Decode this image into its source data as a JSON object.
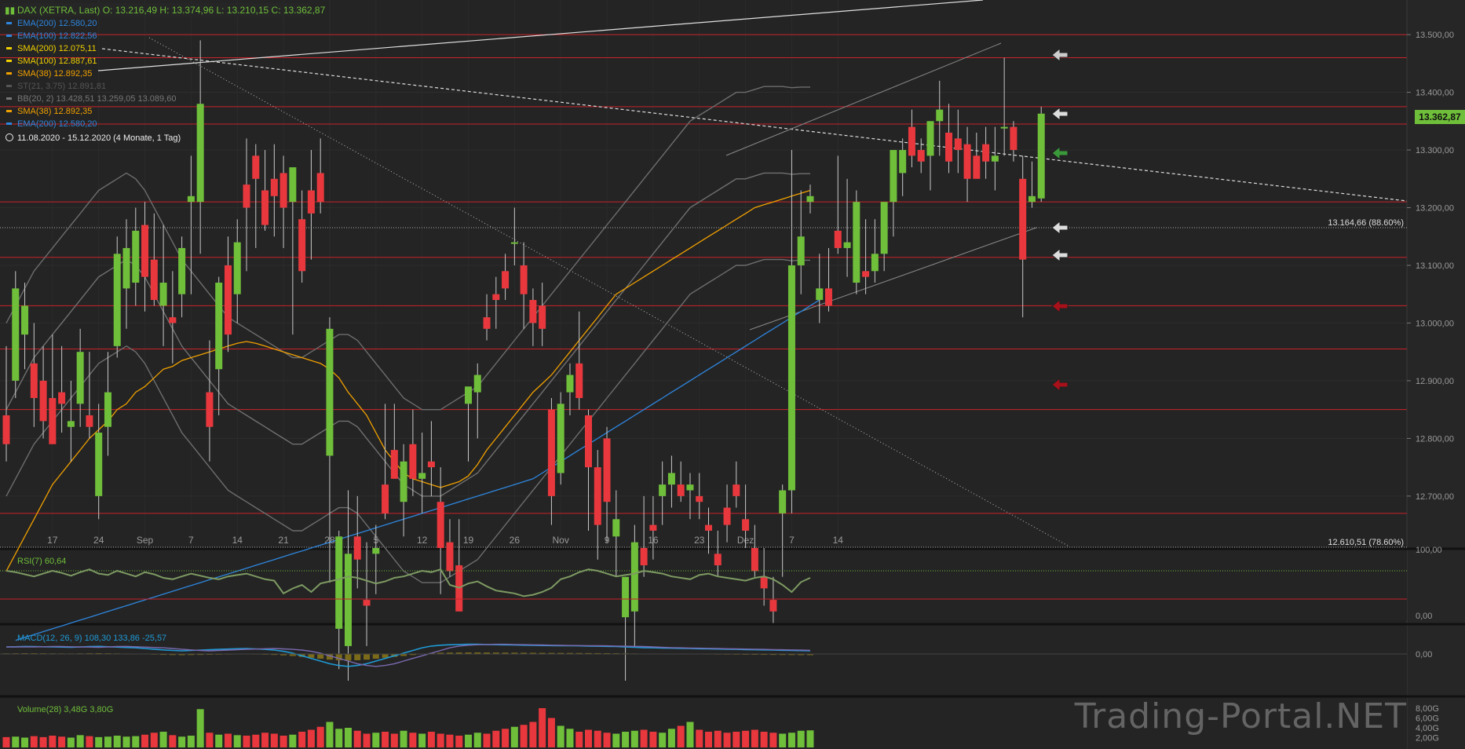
{
  "header": {
    "symbol": "DAX (XETRA, Last)",
    "ohlc": "O: 13.216,49  H: 13.374,96  L: 13.210,15  C: 13.362,87",
    "range": "11.08.2020 - 15.12.2020",
    "range_note": "(4 Monate, 1 Tag)"
  },
  "legend": [
    {
      "name": "EMA(200)",
      "value": "12.580,20",
      "color": "#2e86de"
    },
    {
      "name": "EMA(100)",
      "value": "12.822,56",
      "color": "#2e86de"
    },
    {
      "name": "SMA(200)",
      "value": "12.075,11",
      "color": "#f0d000"
    },
    {
      "name": "SMA(100)",
      "value": "12.887,61",
      "color": "#f0d000"
    },
    {
      "name": "SMA(38)",
      "value": "12.892,35",
      "color": "#f0a000"
    },
    {
      "name": "ST(21, 3.75)",
      "value": "12.891,81",
      "color": "#555555"
    },
    {
      "name": "BB(20, 2)",
      "value": "13.428,51  13.259,05  13.089,60",
      "color": "#777777"
    },
    {
      "name": "SMA(38)",
      "value": "12.892,35",
      "color": "#f0a000"
    },
    {
      "name": "EMA(200)",
      "value": "12.580,20",
      "color": "#2e86de"
    }
  ],
  "price_badge": "13.362,87",
  "fib_labels": {
    "upper": "13.164,66 (88.60%)",
    "lower": "12.610,51 (78.60%)"
  },
  "brand": "Trading-Portal.NET",
  "chart_data": {
    "type": "candlestick",
    "y_axis": {
      "min": 12610,
      "max": 13560,
      "ticks": [
        "13.500,00",
        "13.400,00",
        "13.300,00",
        "13.200,00",
        "13.100,00",
        "13.000,00",
        "12.900,00",
        "12.800,00",
        "12.700,00"
      ],
      "tick_values": [
        13500,
        13400,
        13300,
        13200,
        13100,
        13000,
        12900,
        12800,
        12700
      ]
    },
    "x_ticks": [
      "17",
      "24",
      "Sep",
      "7",
      "14",
      "21",
      "28",
      "5",
      "12",
      "19",
      "26",
      "Nov",
      "9",
      "16",
      "23",
      "Dez",
      "7",
      "14"
    ],
    "x_tick_index": [
      5,
      10,
      15,
      20,
      25,
      30,
      35,
      40,
      45,
      50,
      55,
      60,
      65,
      70,
      75,
      80,
      85,
      90
    ],
    "candles": [
      [
        12840,
        12960,
        12760,
        12790
      ],
      [
        12900,
        13090,
        12870,
        13060
      ],
      [
        12980,
        13070,
        12920,
        13030
      ],
      [
        12930,
        13000,
        12820,
        12870
      ],
      [
        12900,
        12960,
        12800,
        12830
      ],
      [
        12870,
        12980,
        12810,
        12790
      ],
      [
        12880,
        12960,
        12810,
        12860
      ],
      [
        12820,
        12900,
        12760,
        12830
      ],
      [
        12860,
        12990,
        12820,
        12950
      ],
      [
        12840,
        12950,
        12800,
        12820
      ],
      [
        12700,
        12860,
        12660,
        12810
      ],
      [
        12820,
        12950,
        12770,
        12880
      ],
      [
        12960,
        13150,
        12940,
        13120
      ],
      [
        13060,
        13180,
        12990,
        13130
      ],
      [
        13070,
        13200,
        13030,
        13160
      ],
      [
        13170,
        13210,
        13020,
        13080
      ],
      [
        13110,
        13190,
        13030,
        13040
      ],
      [
        13030,
        13170,
        12960,
        13070
      ],
      [
        13010,
        13090,
        12930,
        13000
      ],
      [
        13050,
        13150,
        13010,
        13130
      ],
      [
        13210,
        13290,
        13050,
        13220
      ],
      [
        13210,
        13490,
        13120,
        13380
      ],
      [
        12880,
        12970,
        12760,
        12820
      ],
      [
        12920,
        13080,
        12840,
        13070
      ],
      [
        13100,
        13150,
        12950,
        12980
      ],
      [
        13050,
        13180,
        13000,
        13140
      ],
      [
        13240,
        13320,
        13090,
        13200
      ],
      [
        13290,
        13310,
        13130,
        13250
      ],
      [
        13230,
        13300,
        13160,
        13170
      ],
      [
        13250,
        13310,
        13150,
        13220
      ],
      [
        13260,
        13290,
        13130,
        13200
      ],
      [
        13210,
        13250,
        12980,
        13270
      ],
      [
        13180,
        13230,
        13070,
        13090
      ],
      [
        13230,
        13300,
        13110,
        13190
      ],
      [
        13260,
        13320,
        13190,
        13210
      ],
      [
        12770,
        13010,
        12550,
        12990
      ],
      [
        12470,
        12640,
        12400,
        12630
      ],
      [
        12440,
        12710,
        12380,
        12600
      ],
      [
        12630,
        12700,
        12540,
        12590
      ],
      [
        12520,
        12620,
        12440,
        12510
      ],
      [
        12600,
        12650,
        12530,
        12610
      ],
      [
        12720,
        12860,
        12660,
        12670
      ],
      [
        12780,
        12860,
        12740,
        12730
      ],
      [
        12690,
        12790,
        12630,
        12760
      ],
      [
        12790,
        12850,
        12700,
        12730
      ],
      [
        12730,
        12810,
        12670,
        12740
      ],
      [
        12760,
        12830,
        12700,
        12750
      ],
      [
        12690,
        12750,
        12530,
        12610
      ],
      [
        12620,
        12660,
        12560,
        12570
      ],
      [
        12580,
        12660,
        12520,
        12500
      ],
      [
        12860,
        12880,
        12760,
        12890
      ],
      [
        12880,
        12930,
        12800,
        12910
      ],
      [
        13010,
        13050,
        12970,
        12990
      ],
      [
        13050,
        13080,
        12990,
        13040
      ],
      [
        13090,
        13120,
        13040,
        13060
      ],
      [
        13140,
        13200,
        13100,
        13140
      ],
      [
        13100,
        13140,
        12990,
        13050
      ],
      [
        13040,
        13060,
        12960,
        13000
      ],
      [
        13030,
        13070,
        12960,
        12990
      ],
      [
        12850,
        12870,
        12650,
        12700
      ],
      [
        12740,
        12880,
        12720,
        12860
      ],
      [
        12880,
        12930,
        12840,
        12910
      ],
      [
        12930,
        13020,
        12850,
        12870
      ],
      [
        12840,
        12850,
        12640,
        12750
      ],
      [
        12750,
        12780,
        12590,
        12650
      ],
      [
        12800,
        12820,
        12620,
        12690
      ],
      [
        12630,
        12710,
        12560,
        12660
      ],
      [
        12490,
        12560,
        12380,
        12560
      ],
      [
        12500,
        12650,
        12440,
        12620
      ],
      [
        12610,
        12700,
        12560,
        12580
      ],
      [
        12650,
        12700,
        12590,
        12640
      ],
      [
        12700,
        12760,
        12650,
        12720
      ],
      [
        12720,
        12770,
        12680,
        12740
      ],
      [
        12720,
        12760,
        12690,
        12700
      ],
      [
        12710,
        12740,
        12660,
        12720
      ],
      [
        12700,
        12740,
        12660,
        12690
      ],
      [
        12650,
        12680,
        12600,
        12640
      ],
      [
        12600,
        12640,
        12560,
        12580
      ],
      [
        12680,
        12720,
        12620,
        12650
      ],
      [
        12720,
        12760,
        12680,
        12700
      ],
      [
        12660,
        12720,
        12610,
        12640
      ],
      [
        12610,
        12650,
        12560,
        12570
      ],
      [
        12560,
        12610,
        12510,
        12540
      ],
      [
        12520,
        12560,
        12480,
        12500
      ],
      [
        12670,
        12720,
        12560,
        12710
      ],
      [
        12710,
        13300,
        12670,
        13100
      ],
      [
        13100,
        13230,
        13050,
        13150
      ],
      [
        13210,
        13240,
        13190,
        13220
      ],
      [
        13040,
        13120,
        13000,
        13060
      ],
      [
        13060,
        13130,
        13020,
        13030
      ],
      [
        13160,
        13290,
        13120,
        13130
      ],
      [
        13130,
        13250,
        13080,
        13140
      ],
      [
        13070,
        13230,
        13050,
        13210
      ],
      [
        13090,
        13180,
        13050,
        13080
      ],
      [
        13090,
        13180,
        13070,
        13120
      ],
      [
        13120,
        13200,
        13090,
        13210
      ],
      [
        13210,
        13250,
        13150,
        13300
      ],
      [
        13260,
        13320,
        13220,
        13300
      ],
      [
        13340,
        13370,
        13270,
        13290
      ],
      [
        13300,
        13320,
        13260,
        13280
      ],
      [
        13290,
        13320,
        13230,
        13350
      ],
      [
        13350,
        13420,
        13290,
        13370
      ],
      [
        13330,
        13380,
        13260,
        13280
      ],
      [
        13320,
        13370,
        13260,
        13300
      ],
      [
        13310,
        13340,
        13210,
        13250
      ],
      [
        13290,
        13330,
        13260,
        13250
      ],
      [
        13310,
        13340,
        13250,
        13280
      ],
      [
        13280,
        13340,
        13230,
        13290
      ],
      [
        13340,
        13460,
        13290,
        13340
      ],
      [
        13340,
        13350,
        13280,
        13300
      ],
      [
        13250,
        13290,
        13010,
        13110
      ],
      [
        13210,
        13280,
        13200,
        13220
      ],
      [
        13216,
        13375,
        13210,
        13363
      ]
    ],
    "sma38": [
      12570,
      12600,
      12630,
      12660,
      12690,
      12720,
      12740,
      12760,
      12780,
      12800,
      12815,
      12830,
      12850,
      12860,
      12880,
      12890,
      12905,
      12920,
      12925,
      12935,
      12940,
      12945,
      12950,
      12955,
      12960,
      12965,
      12968,
      12965,
      12960,
      12955,
      12950,
      12945,
      12940,
      12935,
      12930,
      12920,
      12905,
      12880,
      12860,
      12840,
      12810,
      12780,
      12760,
      12740,
      12730,
      12725,
      12720,
      12715,
      12720,
      12725,
      12735,
      12755,
      12780,
      12800,
      12820,
      12840,
      12860,
      12880,
      12895,
      12910,
      12930,
      12950,
      12970,
      12990,
      13010,
      13030,
      13050,
      13060,
      13070,
      13080,
      13090,
      13100,
      13110,
      13120,
      13130,
      13140,
      13150,
      13160,
      13170,
      13180,
      13190,
      13200,
      13205,
      13210,
      13215,
      13220,
      13225,
      13230
    ],
    "bb_mid": [
      12850,
      12880,
      12910,
      12940,
      12960,
      12980,
      13000,
      13020,
      13040,
      13060,
      13080,
      13090,
      13100,
      13110,
      13100,
      13080,
      13050,
      13020,
      12990,
      12960,
      12940,
      12920,
      12900,
      12880,
      12860,
      12850,
      12840,
      12830,
      12820,
      12810,
      12800,
      12790,
      12790,
      12800,
      12810,
      12820,
      12830,
      12830,
      12820,
      12800,
      12780,
      12760,
      12740,
      12720,
      12710,
      12700,
      12700,
      12700,
      12710,
      12720,
      12730,
      12740,
      12760,
      12780,
      12800,
      12820,
      12840,
      12860,
      12880,
      12900,
      12920,
      12940,
      12960,
      12980,
      13000,
      13020,
      13040,
      13060,
      13080,
      13100,
      13120,
      13140,
      13160,
      13180,
      13200,
      13210,
      13220,
      13230,
      13240,
      13250,
      13250,
      13255,
      13260,
      13260,
      13260,
      13258,
      13259,
      13259
    ],
    "ema200": [
      12450,
      12455,
      12460,
      12465,
      12470,
      12475,
      12480,
      12485,
      12490,
      12495,
      12500,
      12505,
      12510,
      12515,
      12520,
      12525,
      12530,
      12535,
      12540,
      12545,
      12550,
      12555,
      12560,
      12565,
      12570,
      12575,
      12580,
      12585,
      12590,
      12595,
      12600,
      12605,
      12610,
      12615,
      12620,
      12625,
      12630,
      12635,
      12640,
      12645,
      12650,
      12655,
      12660,
      12665,
      12670,
      12675,
      12680,
      12685,
      12690,
      12695,
      12700,
      12705,
      12710,
      12715,
      12720,
      12725,
      12730,
      12740,
      12750,
      12760,
      12770,
      12780,
      12790,
      12800,
      12810,
      12820,
      12830,
      12840,
      12850,
      12860,
      12870,
      12880,
      12890,
      12900,
      12910,
      12920,
      12930,
      12940,
      12950,
      12960,
      12970,
      12980,
      12990,
      13000,
      13010,
      13020,
      13030,
      13040
    ],
    "rsi7": [
      70,
      68,
      65,
      62,
      66,
      70,
      67,
      63,
      68,
      72,
      66,
      64,
      70,
      66,
      62,
      68,
      65,
      60,
      58,
      62,
      66,
      63,
      60,
      58,
      62,
      64,
      66,
      62,
      58,
      56,
      38,
      45,
      50,
      40,
      52,
      55,
      58,
      62,
      60,
      56,
      52,
      55,
      60,
      62,
      66,
      70,
      68,
      72,
      50,
      46,
      52,
      55,
      48,
      42,
      40,
      38,
      34,
      36,
      40,
      46,
      58,
      62,
      68,
      72,
      70,
      66,
      62,
      64,
      66,
      70,
      68,
      66,
      62,
      60,
      58,
      64,
      66,
      62,
      60,
      58,
      56,
      60,
      62,
      58,
      50,
      40,
      54,
      60
    ],
    "macd_line": [
      80,
      82,
      85,
      84,
      82,
      80,
      78,
      76,
      80,
      84,
      86,
      82,
      78,
      74,
      70,
      62,
      54,
      46,
      40,
      36,
      40,
      44,
      48,
      52,
      56,
      60,
      62,
      58,
      52,
      44,
      30,
      10,
      -20,
      -50,
      -80,
      -110,
      -130,
      -140,
      -130,
      -110,
      -80,
      -50,
      -20,
      10,
      40,
      70,
      90,
      100,
      105,
      108,
      110,
      110,
      108,
      106,
      104,
      102,
      100,
      98,
      96,
      95,
      94,
      93,
      92,
      90,
      88,
      86,
      84,
      80,
      76,
      72,
      70,
      68,
      66,
      64,
      62,
      60,
      58,
      56,
      54,
      52,
      50,
      48,
      46,
      44,
      42,
      40,
      38,
      36
    ],
    "volume": [
      2.1,
      2.2,
      2.0,
      2.3,
      2.1,
      2.4,
      2.2,
      2.0,
      2.5,
      2.3,
      2.1,
      2.2,
      2.4,
      2.2,
      2.3,
      2.6,
      3.0,
      3.2,
      2.5,
      2.2,
      2.4,
      7.8,
      3.0,
      2.6,
      2.8,
      2.5,
      2.4,
      2.6,
      3.0,
      2.8,
      2.4,
      2.6,
      3.2,
      3.6,
      4.2,
      5.2,
      3.8,
      4.0,
      3.4,
      2.8,
      3.0,
      3.2,
      2.8,
      3.4,
      3.0,
      2.8,
      3.2,
      2.8,
      2.6,
      2.4,
      2.6,
      3.0,
      2.8,
      3.4,
      3.8,
      4.2,
      4.6,
      5.2,
      8.0,
      6.0,
      4.4,
      3.8,
      3.2,
      3.6,
      3.4,
      3.0,
      2.8,
      3.2,
      3.4,
      3.6,
      3.2,
      3.0,
      3.8,
      4.4,
      5.2,
      3.6,
      3.2,
      3.4,
      3.0,
      3.2,
      3.4,
      3.6,
      3.2,
      3.0,
      2.8,
      3.0,
      3.4,
      3.48
    ],
    "horizontal_levels": [
      13500,
      13460,
      13375,
      13345,
      13210,
      13114,
      13030,
      12955,
      12850,
      12670
    ],
    "sub_axes": {
      "rsi": [
        "100,00",
        "0,00"
      ],
      "macd": [
        "0,00"
      ],
      "volume": [
        "8,00G",
        "6,00G",
        "4,00G",
        "2,00G"
      ]
    },
    "rsi_label": "RSI(7)",
    "rsi_value": "60,64",
    "macd_label": "MACD(12, 26, 9)",
    "macd_values": [
      "108,30",
      "133,86",
      "-25,57"
    ],
    "volume_label": "Volume(28)",
    "volume_values": [
      "3,48G",
      "3,80G"
    ]
  }
}
